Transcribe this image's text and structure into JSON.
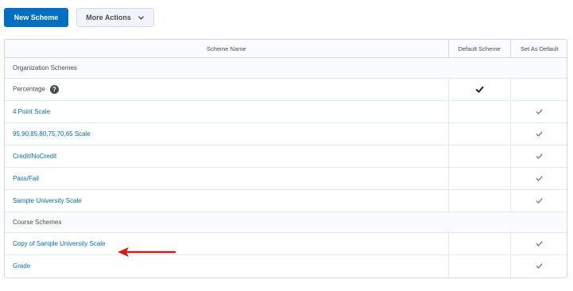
{
  "toolbar": {
    "new_scheme_label": "New Scheme",
    "more_actions_label": "More Actions",
    "more_actions_icon": "chevron-down-icon"
  },
  "table": {
    "columns": [
      "Scheme Name",
      "Default Scheme",
      "Set As Default"
    ],
    "sections": [
      {
        "title": "Organization Schemes",
        "rows": [
          {
            "name": "Percentage",
            "is_link": false,
            "has_help_icon": true,
            "default": true,
            "set_as_default": false
          },
          {
            "name": "4 Point Scale",
            "is_link": true,
            "default": false,
            "set_as_default": true
          },
          {
            "name": "95,90,85,80,75,70,65 Scale",
            "is_link": true,
            "default": false,
            "set_as_default": true
          },
          {
            "name": "Credit/NoCredit",
            "is_link": true,
            "default": false,
            "set_as_default": true
          },
          {
            "name": "Pass/Fail",
            "is_link": true,
            "default": false,
            "set_as_default": true
          },
          {
            "name": "Sample University Scale",
            "is_link": true,
            "default": false,
            "set_as_default": true
          }
        ]
      },
      {
        "title": "Course Schemes",
        "rows": [
          {
            "name": "Copy of Sample University Scale",
            "is_link": true,
            "default": false,
            "set_as_default": true,
            "annotated_with_arrow": true
          },
          {
            "name": "Grade",
            "is_link": true,
            "default": false,
            "set_as_default": true
          }
        ]
      }
    ]
  },
  "colors": {
    "primary": "#006fbf",
    "link": "#006fbf",
    "annotation_arrow": "#cc1f1a"
  }
}
